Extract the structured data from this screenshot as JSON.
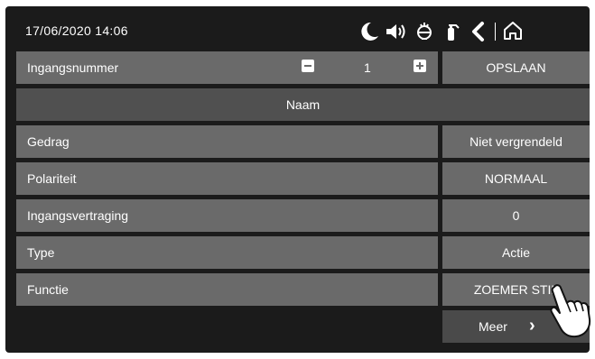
{
  "status_bar": {
    "datetime": "17/06/2020  14:06"
  },
  "rows": {
    "input_number_label": "Ingangsnummer",
    "input_number_value": "1",
    "save_label": "OPSLAAN",
    "name_label": "Naam",
    "behavior_label": "Gedrag",
    "behavior_value": "Niet vergrendeld",
    "polarity_label": "Polariteit",
    "polarity_value": "NORMAAL",
    "delay_label": "Ingangsvertraging",
    "delay_value": "0",
    "type_label": "Type",
    "type_value": "Actie",
    "function_label": "Functie",
    "function_value": "ZOEMER STIL"
  },
  "more": {
    "label": "Meer",
    "chevron": "›"
  }
}
